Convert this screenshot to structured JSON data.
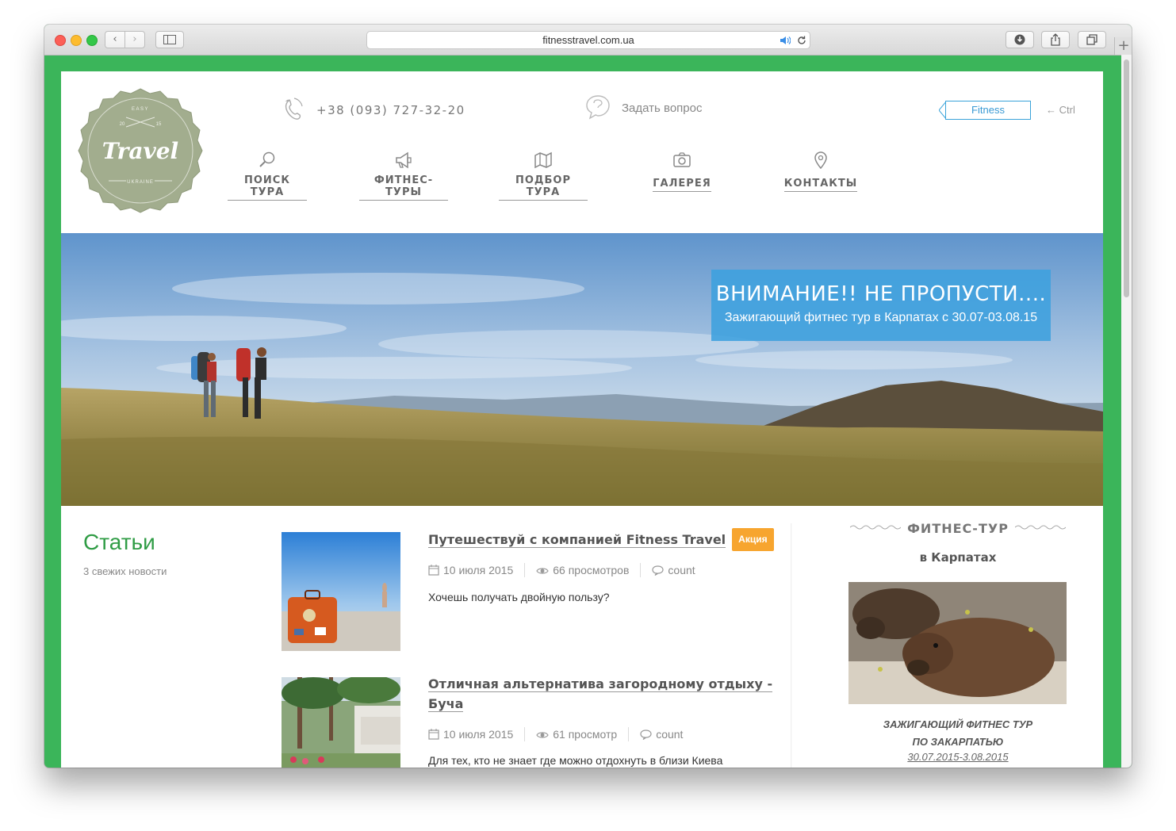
{
  "browser": {
    "url": "fitnesstravel.com.ua",
    "back_label": "‹",
    "forward_label": "›"
  },
  "logo": {
    "text": "Travel",
    "top_text": "EASY",
    "year_left": "20",
    "year_right": "15",
    "bottom_text": "UKRAINE"
  },
  "header": {
    "phone": "+38 (093) 727-32-20",
    "ask": "Задать вопрос",
    "fitness_button": "Fitness",
    "ctrl": "← Ctrl"
  },
  "nav": {
    "items": [
      {
        "label": "ПОИСК ТУРА",
        "icon": "search-icon"
      },
      {
        "label": "ФИТНЕС-ТУРЫ",
        "icon": "megaphone-icon"
      },
      {
        "label": "ПОДБОР ТУРА",
        "icon": "map-icon"
      },
      {
        "label": "ГАЛЕРЕЯ",
        "icon": "camera-icon"
      },
      {
        "label": "КОНТАКТЫ",
        "icon": "location-pin-icon"
      }
    ]
  },
  "hero": {
    "title": "ВНИМАНИЕ!! НЕ ПРОПУСТИ....",
    "subtitle": "Зажигающий фитнес тур в Карпатах с 30.07-03.08.15"
  },
  "articles": {
    "title": "Статьи",
    "subtitle": "3 свежих новости",
    "posts": [
      {
        "title": "Путешествуй с компанией Fitness Travel",
        "badge": "Акция",
        "date": "10 июля 2015",
        "views": "66 просмотров",
        "comments": "count",
        "excerpt": "Хочешь получать двойную пользу?"
      },
      {
        "title_line1": "Отличная альтернатива загородному отдыху -",
        "title_line2": "Буча",
        "date": "10 июля 2015",
        "views": "61 просмотр",
        "comments": "count",
        "excerpt": "Для тех, кто не знает где можно отдохнуть в близи Киева"
      }
    ]
  },
  "sidebar": {
    "title": "ФИТНЕС-ТУР",
    "subtitle": "в Карпатах",
    "caption_line1": "ЗАЖИГАЮЩИЙ ФИТНЕС ТУР",
    "caption_line2": "ПО ЗАКАРПАТЬЮ",
    "date": "30.07.2015-3.08.2015"
  },
  "colors": {
    "page_frame": "#3bb55a",
    "accent_green": "#2f9c45",
    "banner_blue": "#3ea0de",
    "badge_orange": "#f7a52f",
    "fitness_blue": "#3aa3d9"
  }
}
